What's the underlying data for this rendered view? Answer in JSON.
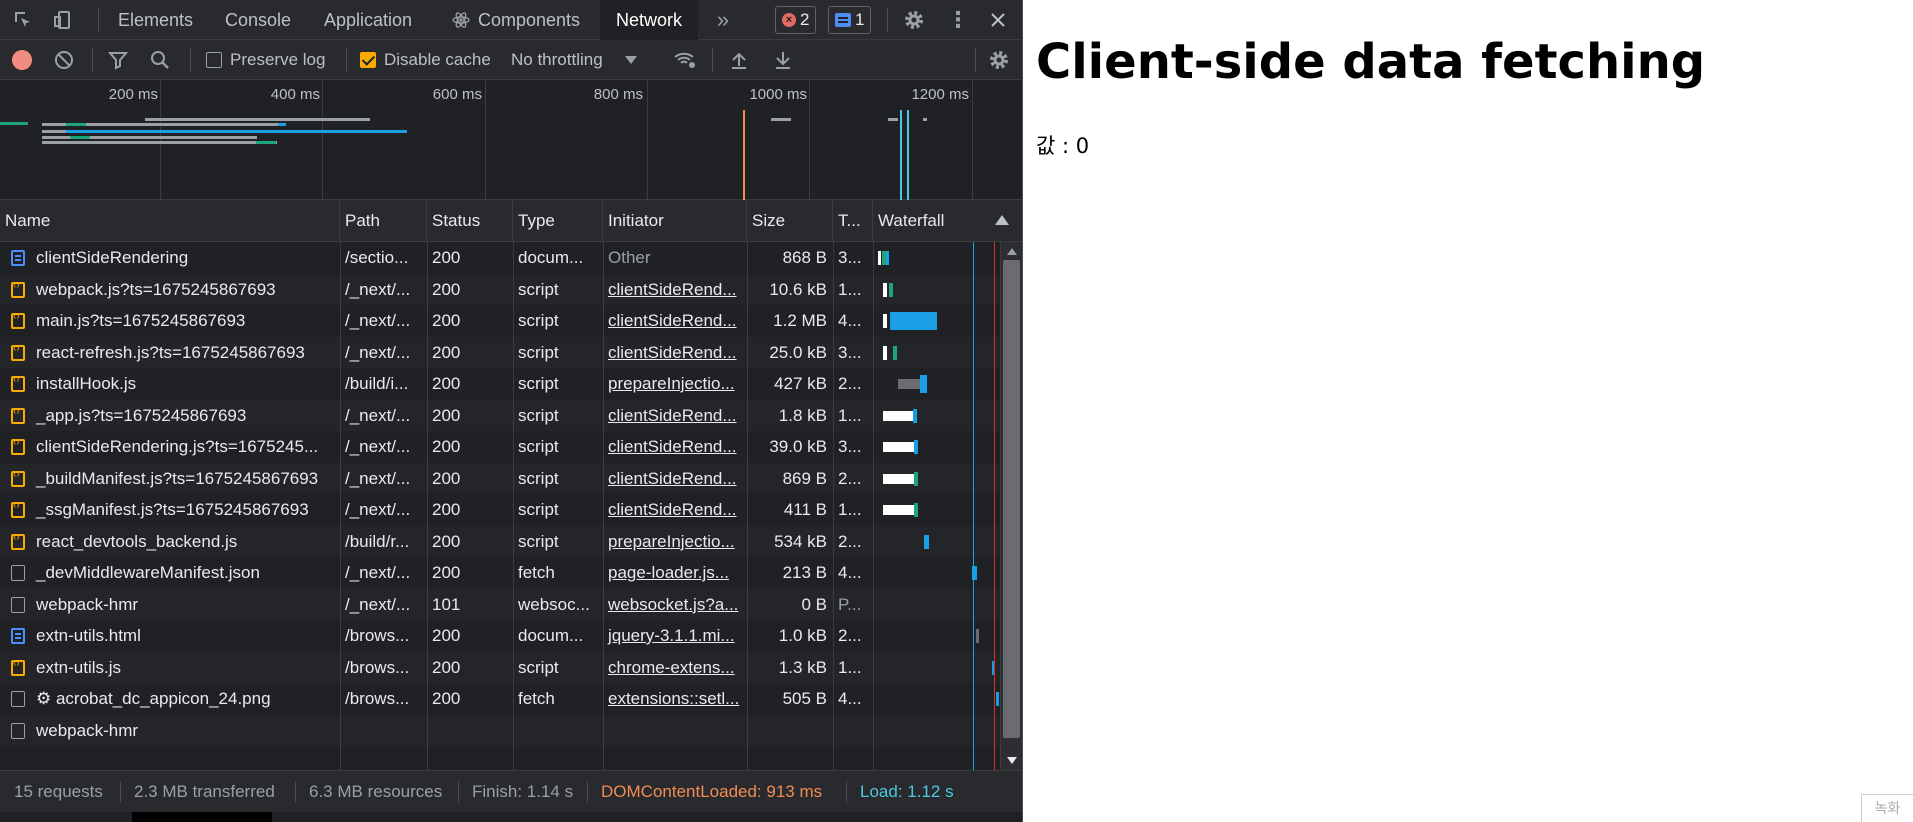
{
  "tabs": [
    {
      "label": "Elements"
    },
    {
      "label": "Console"
    },
    {
      "label": "Application"
    },
    {
      "label": "Components"
    },
    {
      "label": "Network"
    }
  ],
  "badges": {
    "errors": "2",
    "messages": "1"
  },
  "toolbar": {
    "preserve_log": "Preserve log",
    "disable_cache": "Disable cache",
    "throttling": "No throttling"
  },
  "overview": {
    "ticks": [
      "200 ms",
      "400 ms",
      "600 ms",
      "800 ms",
      "1000 ms",
      "1200 ms"
    ]
  },
  "columns": [
    "Name",
    "Path",
    "Status",
    "Type",
    "Initiator",
    "Size",
    "T...",
    "Waterfall"
  ],
  "rows": [
    {
      "name": "clientSideRendering",
      "path": "/sectio...",
      "status": "200",
      "type": "docum...",
      "initiator": "Other",
      "size": "868 B",
      "time": "3...",
      "icon": "doc"
    },
    {
      "name": "webpack.js?ts=1675245867693",
      "path": "/_next/...",
      "status": "200",
      "type": "script",
      "initiator": "clientSideRend...",
      "size": "10.6 kB",
      "time": "1...",
      "icon": "script"
    },
    {
      "name": "main.js?ts=1675245867693",
      "path": "/_next/...",
      "status": "200",
      "type": "script",
      "initiator": "clientSideRend...",
      "size": "1.2 MB",
      "time": "4...",
      "icon": "script"
    },
    {
      "name": "react-refresh.js?ts=1675245867693",
      "path": "/_next/...",
      "status": "200",
      "type": "script",
      "initiator": "clientSideRend...",
      "size": "25.0 kB",
      "time": "3...",
      "icon": "script"
    },
    {
      "name": "installHook.js",
      "path": "/build/i...",
      "status": "200",
      "type": "script",
      "initiator": "prepareInjectio...",
      "size": "427 kB",
      "time": "2...",
      "icon": "script"
    },
    {
      "name": "_app.js?ts=1675245867693",
      "path": "/_next/...",
      "status": "200",
      "type": "script",
      "initiator": "clientSideRend...",
      "size": "1.8 kB",
      "time": "1...",
      "icon": "script"
    },
    {
      "name": "clientSideRendering.js?ts=1675245...",
      "path": "/_next/...",
      "status": "200",
      "type": "script",
      "initiator": "clientSideRend...",
      "size": "39.0 kB",
      "time": "3...",
      "icon": "script"
    },
    {
      "name": "_buildManifest.js?ts=1675245867693",
      "path": "/_next/...",
      "status": "200",
      "type": "script",
      "initiator": "clientSideRend...",
      "size": "869 B",
      "time": "2...",
      "icon": "script"
    },
    {
      "name": "_ssgManifest.js?ts=1675245867693",
      "path": "/_next/...",
      "status": "200",
      "type": "script",
      "initiator": "clientSideRend...",
      "size": "411 B",
      "time": "1...",
      "icon": "script"
    },
    {
      "name": "react_devtools_backend.js",
      "path": "/build/r...",
      "status": "200",
      "type": "script",
      "initiator": "prepareInjectio...",
      "size": "534 kB",
      "time": "2...",
      "icon": "script"
    },
    {
      "name": "_devMiddlewareManifest.json",
      "path": "/_next/...",
      "status": "200",
      "type": "fetch",
      "initiator": "page-loader.js...",
      "size": "213 B",
      "time": "4...",
      "icon": "other"
    },
    {
      "name": "webpack-hmr",
      "path": "/_next/...",
      "status": "101",
      "type": "websoc...",
      "initiator": "websocket.js?a...",
      "size": "0 B",
      "time": "P...",
      "icon": "other"
    },
    {
      "name": "extn-utils.html",
      "path": "/brows...",
      "status": "200",
      "type": "docum...",
      "initiator": "jquery-3.1.1.mi...",
      "size": "1.0 kB",
      "time": "2...",
      "icon": "doc"
    },
    {
      "name": "extn-utils.js",
      "path": "/brows...",
      "status": "200",
      "type": "script",
      "initiator": "chrome-extens...",
      "size": "1.3 kB",
      "time": "1...",
      "icon": "script"
    },
    {
      "name": "⚙ acrobat_dc_appicon_24.png",
      "path": "/brows...",
      "status": "200",
      "type": "fetch",
      "initiator": "extensions::setl...",
      "size": "505 B",
      "time": "4...",
      "icon": "other"
    },
    {
      "name": "webpack-hmr",
      "path": "",
      "status": "",
      "type": "",
      "initiator": "",
      "size": "",
      "time": "",
      "icon": "other"
    }
  ],
  "status": {
    "requests": "15 requests",
    "transferred": "2.3 MB transferred",
    "resources": "6.3 MB resources",
    "finish": "Finish: 1.14 s",
    "dcl": "DOMContentLoaded: 913 ms",
    "load": "Load: 1.12 s"
  },
  "colors": {
    "dcl": "#f28b54",
    "load": "#4ac8e0",
    "accent": "#1a9ee5"
  },
  "page": {
    "heading": "Client-side data fetching",
    "value_text": "값 : 0",
    "corner_text": "녹화"
  }
}
